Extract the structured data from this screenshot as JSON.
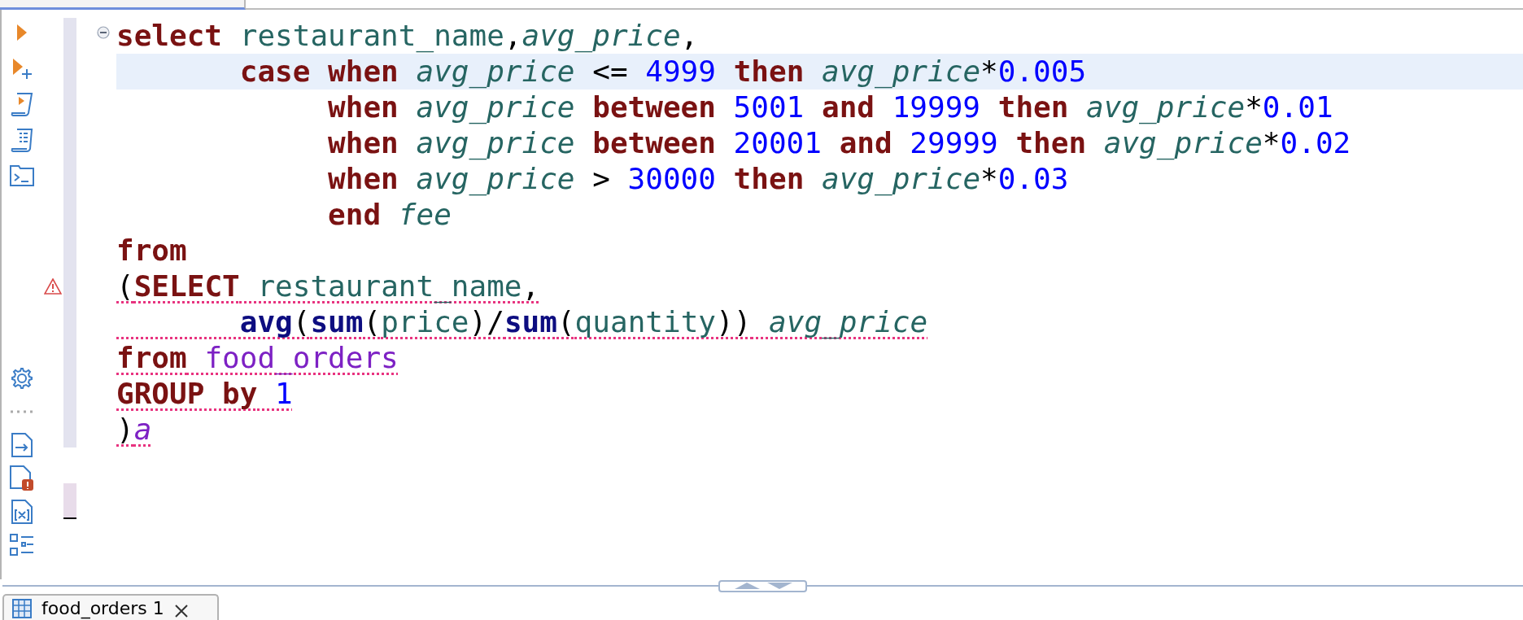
{
  "editor": {
    "lines": [
      {
        "current": false,
        "error": false,
        "fold": {
          "expanded": true
        },
        "tokens": [
          {
            "kind": "keyword",
            "text": "select"
          },
          {
            "kind": "column",
            "text": " restaurant_name"
          },
          {
            "kind": "plain",
            "text": ","
          },
          {
            "kind": "alias",
            "text": "avg_price"
          },
          {
            "kind": "plain",
            "text": ","
          }
        ]
      },
      {
        "current": true,
        "error": false,
        "tokens": [
          {
            "kind": "keyword",
            "text": "       case"
          },
          {
            "kind": "keyword",
            "text": " when"
          },
          {
            "kind": "alias",
            "text": " avg_price"
          },
          {
            "kind": "plain",
            "text": " <="
          },
          {
            "kind": "number",
            "text": " 4999"
          },
          {
            "kind": "keyword",
            "text": " then"
          },
          {
            "kind": "alias",
            "text": " avg_price"
          },
          {
            "kind": "plain",
            "text": "*"
          },
          {
            "kind": "number",
            "text": "0.005"
          }
        ]
      },
      {
        "current": false,
        "error": false,
        "tokens": [
          {
            "kind": "keyword",
            "text": "            when"
          },
          {
            "kind": "alias",
            "text": " avg_price"
          },
          {
            "kind": "keyword",
            "text": " between"
          },
          {
            "kind": "number",
            "text": " 5001"
          },
          {
            "kind": "keyword",
            "text": " and"
          },
          {
            "kind": "number",
            "text": " 19999"
          },
          {
            "kind": "keyword",
            "text": " then"
          },
          {
            "kind": "alias",
            "text": " avg_price"
          },
          {
            "kind": "plain",
            "text": "*"
          },
          {
            "kind": "number",
            "text": "0.01"
          }
        ]
      },
      {
        "current": false,
        "error": false,
        "tokens": [
          {
            "kind": "keyword",
            "text": "            when"
          },
          {
            "kind": "alias",
            "text": " avg_price"
          },
          {
            "kind": "keyword",
            "text": " between"
          },
          {
            "kind": "number",
            "text": " 20001"
          },
          {
            "kind": "keyword",
            "text": " and"
          },
          {
            "kind": "number",
            "text": " 29999"
          },
          {
            "kind": "keyword",
            "text": " then"
          },
          {
            "kind": "alias",
            "text": " avg_price"
          },
          {
            "kind": "plain",
            "text": "*"
          },
          {
            "kind": "number",
            "text": "0.02"
          }
        ]
      },
      {
        "current": false,
        "error": false,
        "tokens": [
          {
            "kind": "keyword",
            "text": "            when"
          },
          {
            "kind": "alias",
            "text": " avg_price"
          },
          {
            "kind": "plain",
            "text": " >"
          },
          {
            "kind": "number",
            "text": " 30000"
          },
          {
            "kind": "keyword",
            "text": " then"
          },
          {
            "kind": "alias",
            "text": " avg_price"
          },
          {
            "kind": "plain",
            "text": "*"
          },
          {
            "kind": "number",
            "text": "0.03"
          }
        ]
      },
      {
        "current": false,
        "error": false,
        "tokens": [
          {
            "kind": "keyword",
            "text": "            end"
          },
          {
            "kind": "alias",
            "text": " fee"
          }
        ]
      },
      {
        "current": false,
        "error": false,
        "tokens": [
          {
            "kind": "keyword",
            "text": "from"
          }
        ]
      },
      {
        "current": false,
        "error": true,
        "warning": true,
        "tokens": [
          {
            "kind": "plain",
            "text": "("
          },
          {
            "kind": "keyword",
            "text": "SELECT"
          },
          {
            "kind": "column",
            "text": " restaurant_name"
          },
          {
            "kind": "plain",
            "text": ","
          }
        ]
      },
      {
        "current": false,
        "error": true,
        "tokens": [
          {
            "kind": "function",
            "text": "       avg"
          },
          {
            "kind": "plain",
            "text": "("
          },
          {
            "kind": "function",
            "text": "sum"
          },
          {
            "kind": "plain",
            "text": "("
          },
          {
            "kind": "column",
            "text": "price"
          },
          {
            "kind": "plain",
            "text": ")/"
          },
          {
            "kind": "function",
            "text": "sum"
          },
          {
            "kind": "plain",
            "text": "("
          },
          {
            "kind": "column",
            "text": "quantity"
          },
          {
            "kind": "plain",
            "text": "))"
          },
          {
            "kind": "alias",
            "text": " avg_price"
          }
        ]
      },
      {
        "current": false,
        "error": true,
        "tokens": [
          {
            "kind": "keyword",
            "text": "from"
          },
          {
            "kind": "table",
            "text": " food_orders"
          }
        ]
      },
      {
        "current": false,
        "error": true,
        "tokens": [
          {
            "kind": "keyword",
            "text": "GROUP by"
          },
          {
            "kind": "number",
            "text": " 1"
          }
        ]
      },
      {
        "current": false,
        "error": true,
        "tokens": [
          {
            "kind": "plain",
            "text": ")"
          },
          {
            "kind": "table_alias",
            "text": "a"
          }
        ]
      }
    ]
  },
  "result_tab": {
    "label": "food_orders 1"
  }
}
